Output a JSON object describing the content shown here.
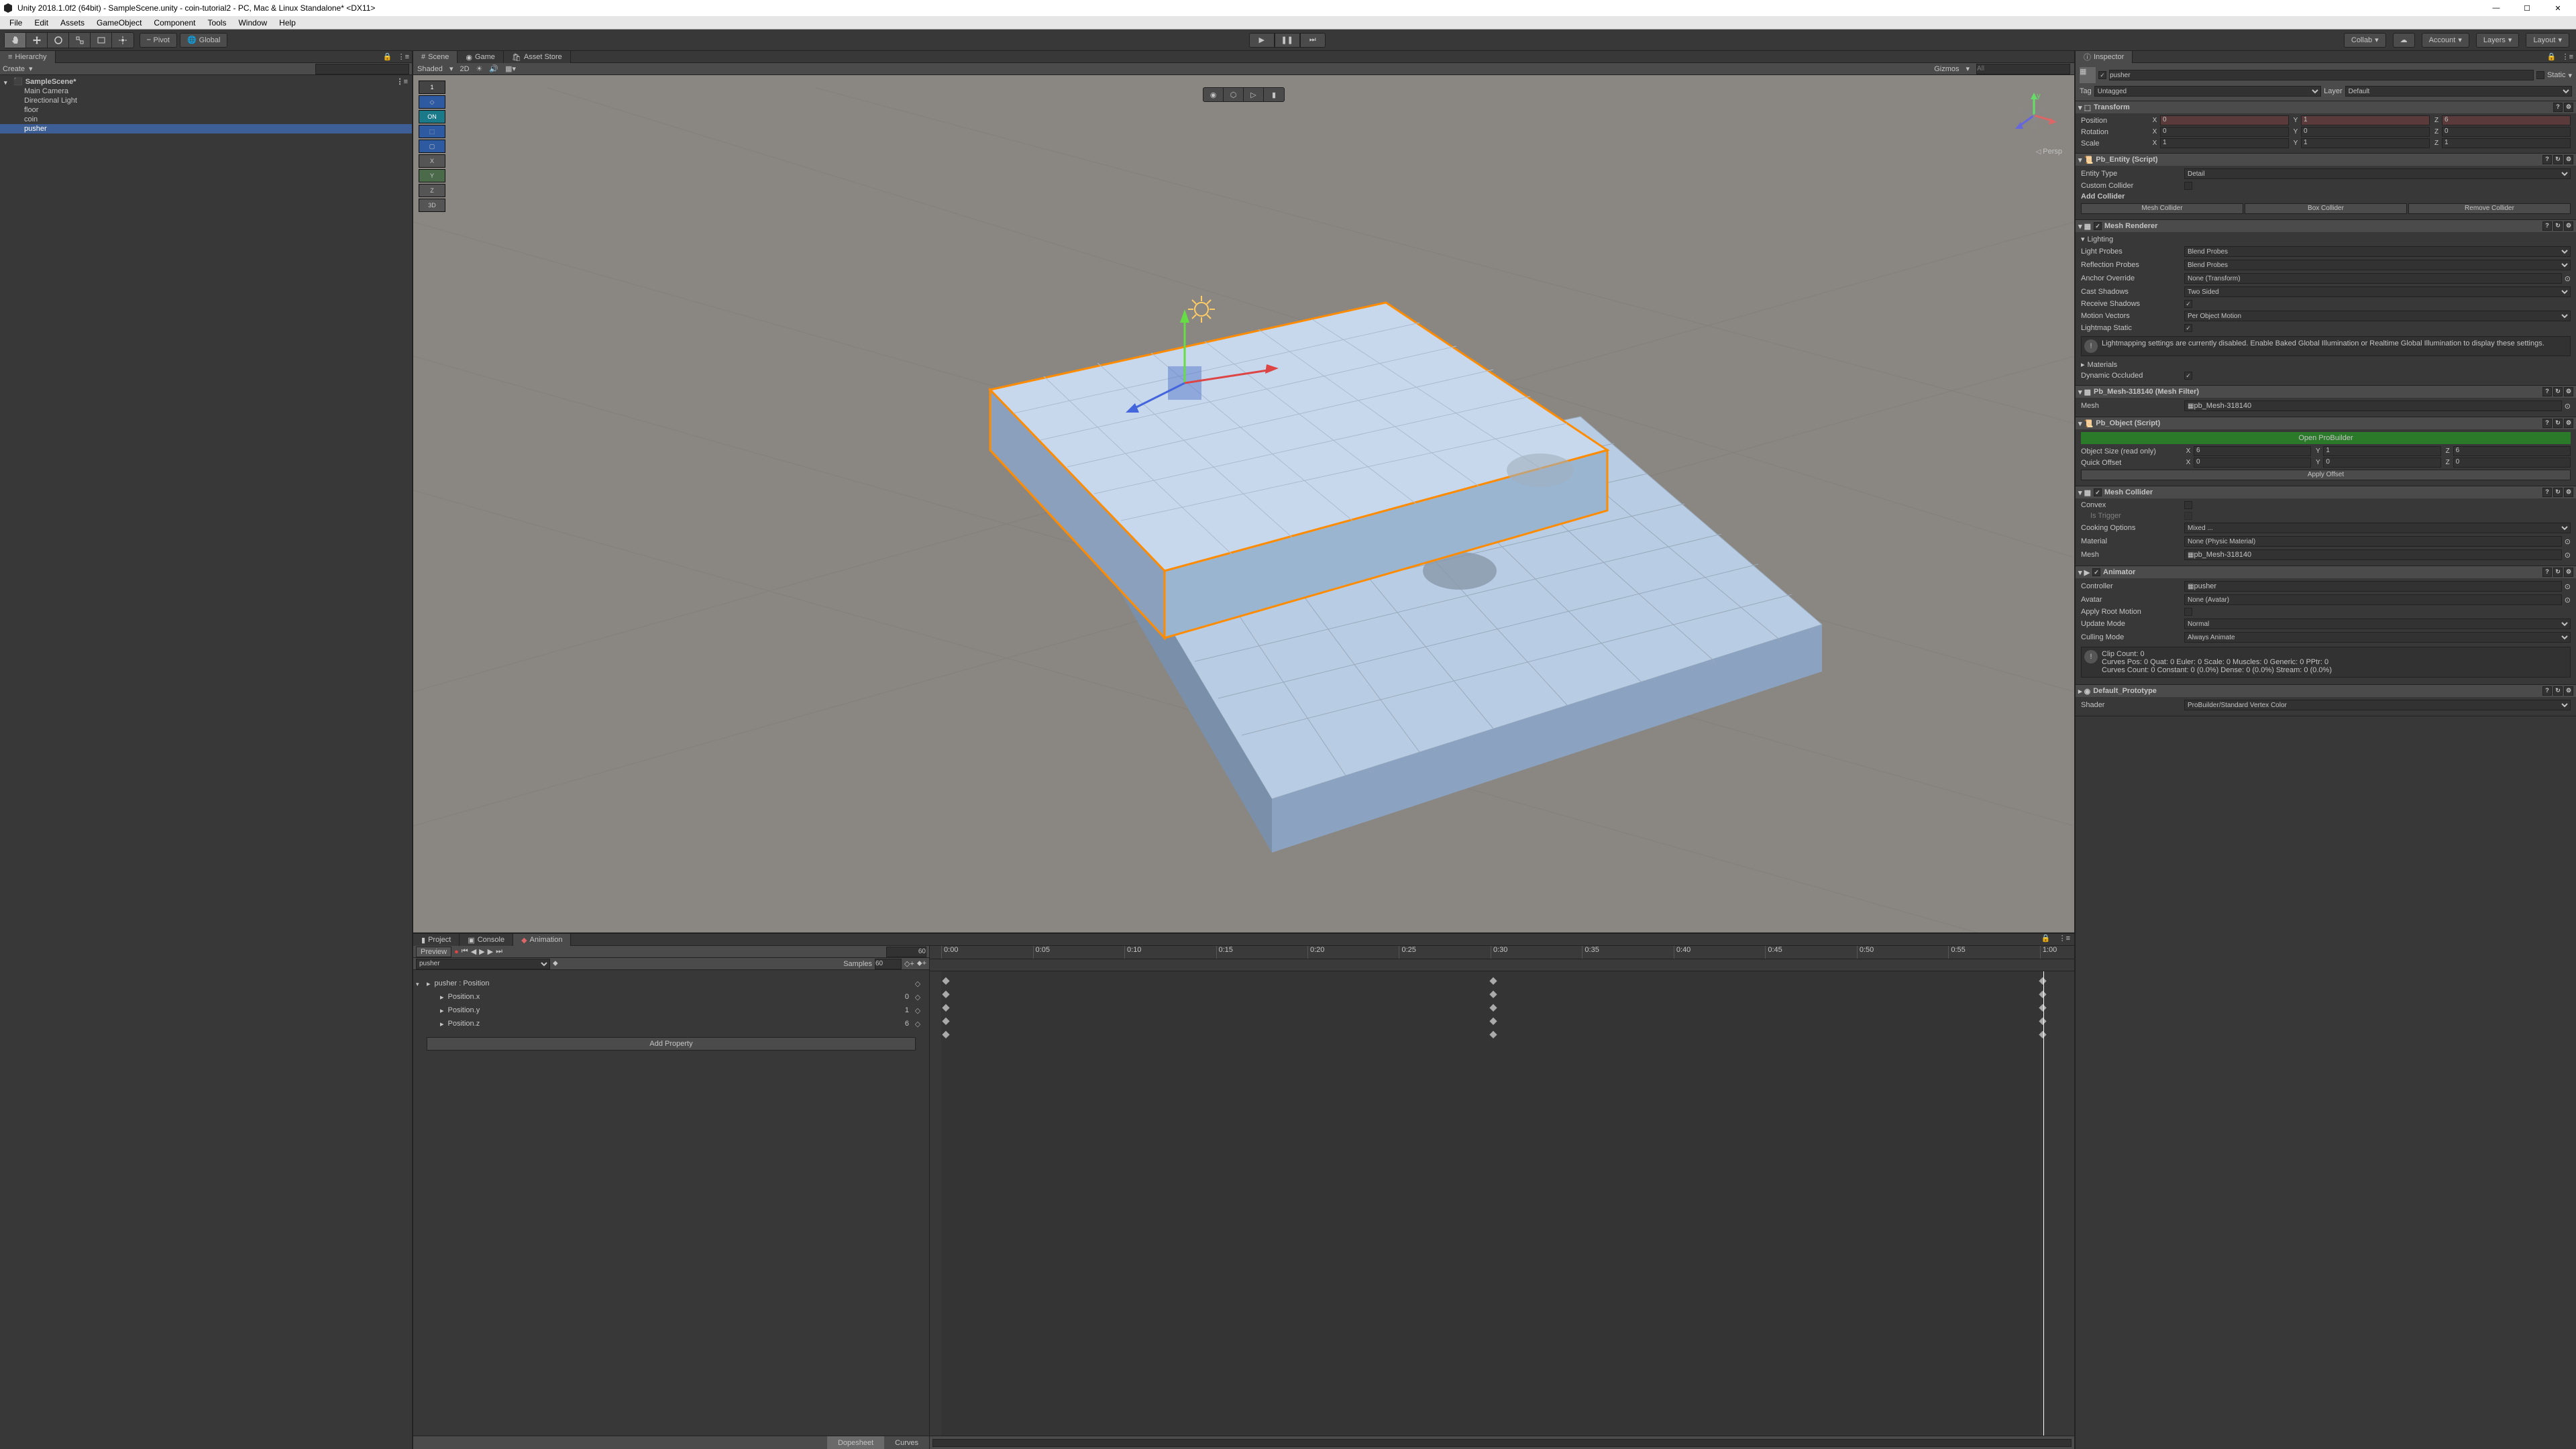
{
  "titlebar": {
    "title": "Unity 2018.1.0f2 (64bit) - SampleScene.unity - coin-tutorial2 - PC, Mac & Linux Standalone* <DX11>"
  },
  "menubar": [
    "File",
    "Edit",
    "Assets",
    "GameObject",
    "Component",
    "Tools",
    "Window",
    "Help"
  ],
  "toolbar": {
    "pivot": "Pivot",
    "global": "Global",
    "collab": "Collab",
    "account": "Account",
    "layers": "Layers",
    "layout": "Layout"
  },
  "hierarchy": {
    "title": "Hierarchy",
    "create": "Create",
    "scene": "SampleScene*",
    "items": [
      "Main Camera",
      "Directional Light",
      "floor",
      "coin",
      "pusher"
    ],
    "selected": "pusher"
  },
  "scene": {
    "tabs": [
      "Scene",
      "Game",
      "Asset Store"
    ],
    "shaded": "Shaded",
    "twod": "2D",
    "gizmos": "Gizmos",
    "persp": "Persp",
    "pb_buttons": [
      "1",
      "",
      "ON",
      "",
      "",
      "X",
      "Y",
      "Z",
      "3D"
    ]
  },
  "bottom": {
    "tabs": [
      "Project",
      "Console",
      "Animation"
    ],
    "active_tab": "Animation",
    "preview": "Preview",
    "frame": "60",
    "clip": "pusher",
    "samples_label": "Samples",
    "samples": "60",
    "property_root": "pusher : Position",
    "properties": [
      {
        "name": "Position.x",
        "value": "0"
      },
      {
        "name": "Position.y",
        "value": "1"
      },
      {
        "name": "Position.z",
        "value": "6"
      }
    ],
    "add_property": "Add Property",
    "ticks": [
      "0:00",
      "0:05",
      "0:10",
      "0:15",
      "0:20",
      "0:25",
      "0:30",
      "0:35",
      "0:40",
      "0:45",
      "0:50",
      "0:55",
      "1:00"
    ],
    "footer": {
      "dopesheet": "Dopesheet",
      "curves": "Curves"
    }
  },
  "inspector": {
    "title": "Inspector",
    "object_name": "pusher",
    "static": "Static",
    "tag_label": "Tag",
    "tag": "Untagged",
    "layer_label": "Layer",
    "layer": "Default",
    "transform": {
      "title": "Transform",
      "position": {
        "label": "Position",
        "x": "0",
        "y": "1",
        "z": "6"
      },
      "rotation": {
        "label": "Rotation",
        "x": "0",
        "y": "0",
        "z": "0"
      },
      "scale": {
        "label": "Scale",
        "x": "1",
        "y": "1",
        "z": "1"
      }
    },
    "pb_entity": {
      "title": "Pb_Entity (Script)",
      "entity_type_label": "Entity Type",
      "entity_type": "Detail",
      "custom_collider_label": "Custom Collider",
      "add_collider": "Add Collider",
      "mesh_collider": "Mesh Collider",
      "box_collider": "Box Collider",
      "remove_collider": "Remove Collider"
    },
    "mesh_renderer": {
      "title": "Mesh Renderer",
      "lighting": "Lighting",
      "light_probes_label": "Light Probes",
      "light_probes": "Blend Probes",
      "reflection_probes_label": "Reflection Probes",
      "reflection_probes": "Blend Probes",
      "anchor_override_label": "Anchor Override",
      "anchor_override": "None (Transform)",
      "cast_shadows_label": "Cast Shadows",
      "cast_shadows": "Two Sided",
      "receive_shadows_label": "Receive Shadows",
      "motion_vectors_label": "Motion Vectors",
      "motion_vectors": "Per Object Motion",
      "lightmap_static_label": "Lightmap Static",
      "lightmap_info": "Lightmapping settings are currently disabled. Enable Baked Global Illumination or Realtime Global Illumination to display these settings.",
      "materials": "Materials",
      "dynamic_occluded_label": "Dynamic Occluded"
    },
    "mesh_filter": {
      "title": "Pb_Mesh-318140 (Mesh Filter)",
      "mesh_label": "Mesh",
      "mesh": "pb_Mesh-318140"
    },
    "pb_object": {
      "title": "Pb_Object (Script)",
      "open_probuilder": "Open ProBuilder",
      "object_size_label": "Object Size (read only)",
      "size": {
        "x": "6",
        "y": "1",
        "z": "6"
      },
      "quick_offset_label": "Quick Offset",
      "offset": {
        "x": "0",
        "y": "0",
        "z": "0"
      },
      "apply_offset": "Apply Offset"
    },
    "mesh_collider": {
      "title": "Mesh Collider",
      "convex_label": "Convex",
      "is_trigger_label": "Is Trigger",
      "cooking_options_label": "Cooking Options",
      "cooking_options": "Mixed ...",
      "material_label": "Material",
      "material": "None (Physic Material)",
      "mesh_label": "Mesh",
      "mesh": "pb_Mesh-318140"
    },
    "animator": {
      "title": "Animator",
      "controller_label": "Controller",
      "controller": "pusher",
      "avatar_label": "Avatar",
      "avatar": "None (Avatar)",
      "apply_root_motion_label": "Apply Root Motion",
      "update_mode_label": "Update Mode",
      "update_mode": "Normal",
      "culling_mode_label": "Culling Mode",
      "culling_mode": "Always Animate",
      "info": "Clip Count: 0\nCurves Pos: 0 Quat: 0 Euler: 0 Scale: 0 Muscles: 0 Generic: 0 PPtr: 0\nCurves Count: 0 Constant: 0 (0.0%) Dense: 0 (0.0%) Stream: 0 (0.0%)"
    },
    "material": {
      "title": "Default_Prototype",
      "shader_label": "Shader",
      "shader": "ProBuilder/Standard Vertex Color"
    }
  }
}
